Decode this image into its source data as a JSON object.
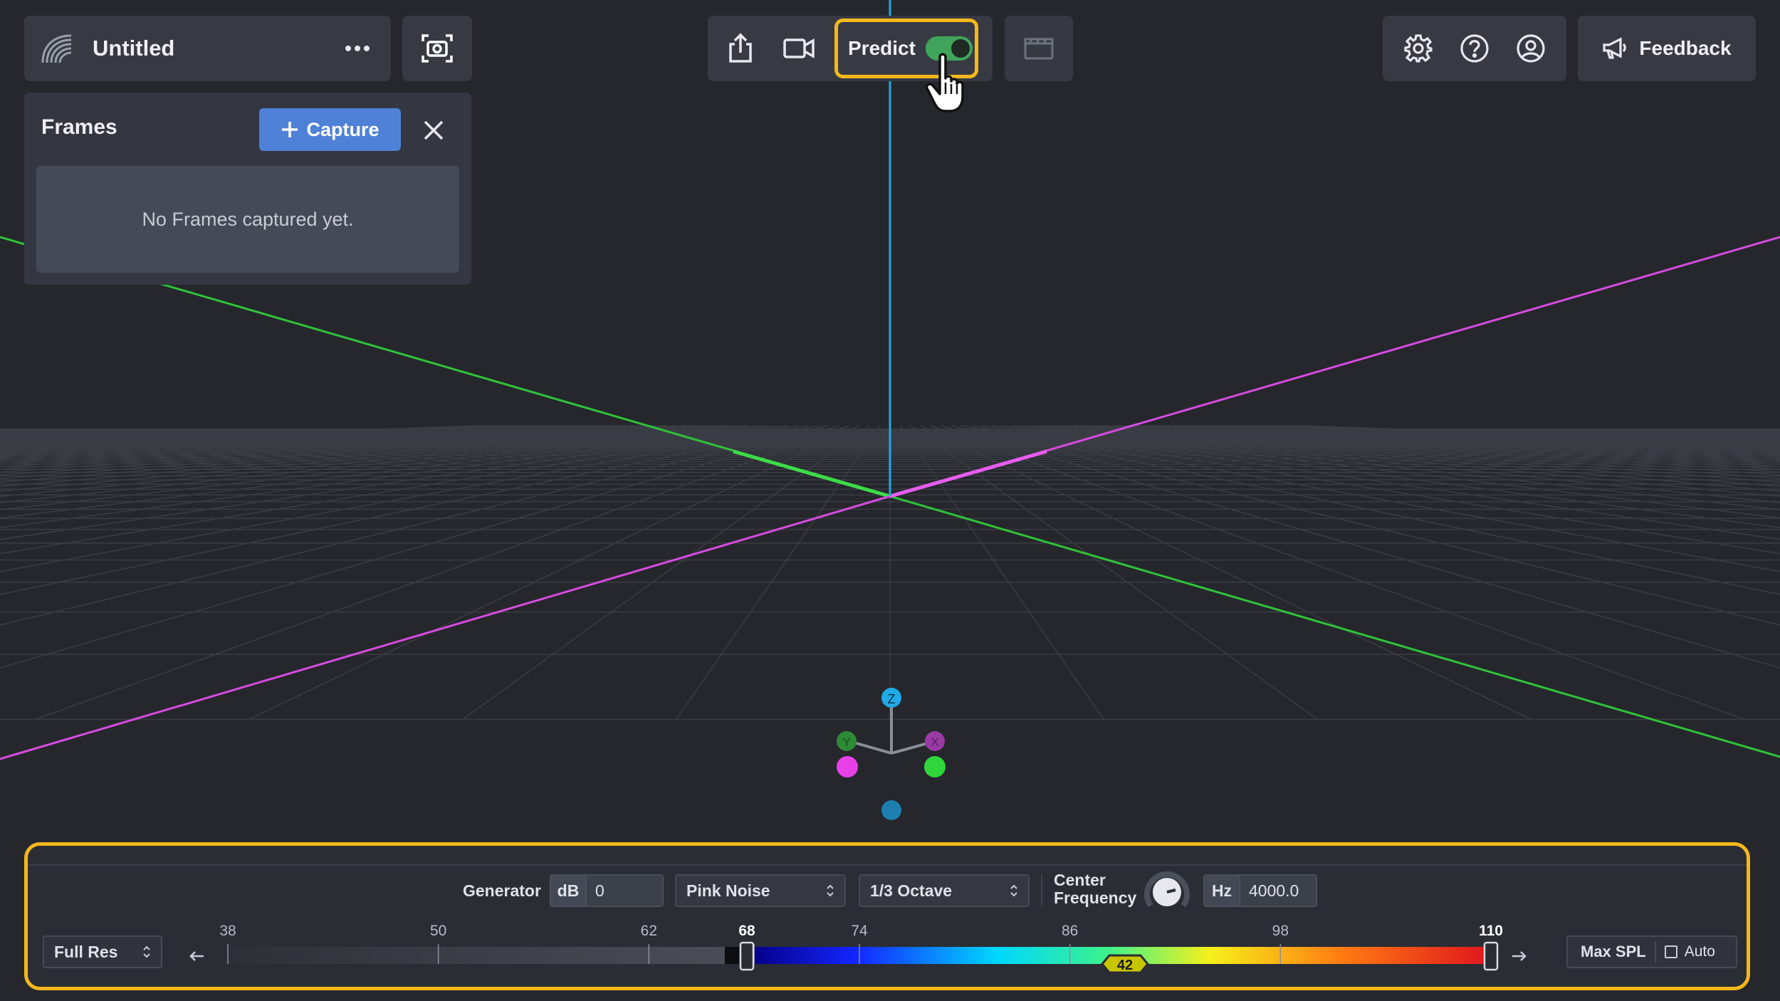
{
  "title_card": {
    "title": "Untitled"
  },
  "frames_panel": {
    "heading": "Frames",
    "capture_label": "Capture",
    "empty_message": "No Frames captured yet."
  },
  "toolbar": {
    "predict_label": "Predict",
    "predict_enabled": true
  },
  "right_toolbar": {
    "feedback_label": "Feedback"
  },
  "bottom_bar": {
    "generator_label": "Generator",
    "db_unit": "dB",
    "db_value": "0",
    "noise_type": "Pink Noise",
    "band": "1/3 Octave",
    "center_frequency_label_line1": "Center",
    "center_frequency_label_line2": "Frequency",
    "hz_unit": "Hz",
    "hz_value": "4000.0",
    "resolution": "Full Res",
    "max_spl_label": "Max SPL",
    "auto_label": "Auto",
    "auto_checked": false,
    "scale": {
      "ticks": [
        "38",
        "50",
        "62",
        "68",
        "74",
        "86",
        "98",
        "110"
      ],
      "min_handle": "68",
      "max_handle": "110",
      "range_badge": "42"
    }
  },
  "axis_gizmo": {
    "z": "Z",
    "y": "Y",
    "x": "X"
  },
  "colors": {
    "accent_highlight": "#f4b81c",
    "capture_button": "#4f81d6",
    "toggle_on": "#3fa55a",
    "axis_x": "#d64be0",
    "axis_y": "#2fc23a",
    "axis_z": "#21a9e8"
  }
}
